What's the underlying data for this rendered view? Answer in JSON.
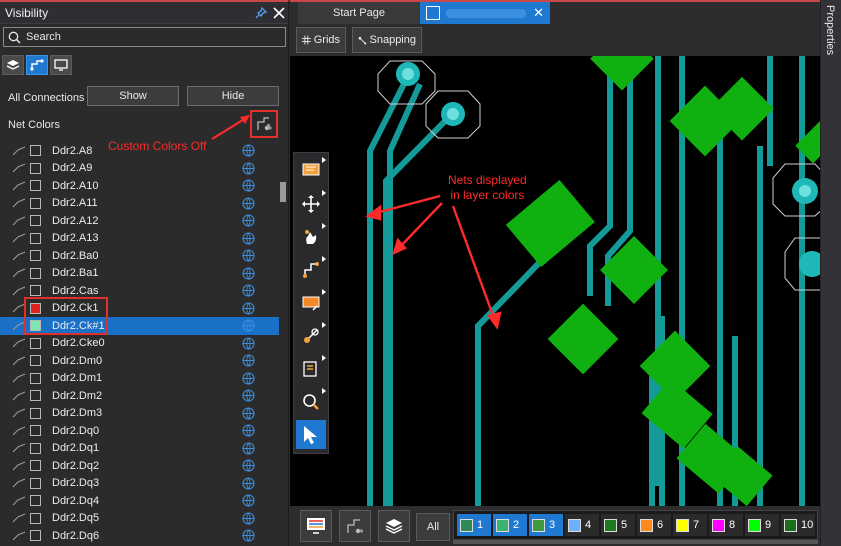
{
  "visibility": {
    "title": "Visibility",
    "search_placeholder": "Search",
    "all_connections_label": "All Connections",
    "show_label": "Show",
    "hide_label": "Hide",
    "net_colors_label": "Net Colors",
    "annotation_custom_colors": "Custom Colors Off",
    "nets": [
      {
        "name": "Ddr2.A8"
      },
      {
        "name": "Ddr2.A9"
      },
      {
        "name": "Ddr2.A10"
      },
      {
        "name": "Ddr2.A11"
      },
      {
        "name": "Ddr2.A12"
      },
      {
        "name": "Ddr2.A13"
      },
      {
        "name": "Ddr2.Ba0"
      },
      {
        "name": "Ddr2.Ba1"
      },
      {
        "name": "Ddr2.Cas"
      },
      {
        "name": "Ddr2.Ck1",
        "color": "#e0241c"
      },
      {
        "name": "Ddr2.Ck#1",
        "color": "#7ee6b0",
        "selected": true
      },
      {
        "name": "Ddr2.Cke0"
      },
      {
        "name": "Ddr2.Dm0"
      },
      {
        "name": "Ddr2.Dm1"
      },
      {
        "name": "Ddr2.Dm2"
      },
      {
        "name": "Ddr2.Dm3"
      },
      {
        "name": "Ddr2.Dq0"
      },
      {
        "name": "Ddr2.Dq1"
      },
      {
        "name": "Ddr2.Dq2"
      },
      {
        "name": "Ddr2.Dq3"
      },
      {
        "name": "Ddr2.Dq4"
      },
      {
        "name": "Ddr2.Dq5"
      },
      {
        "name": "Ddr2.Dq6"
      }
    ]
  },
  "tabs": {
    "start_page": "Start Page"
  },
  "toolbar": {
    "grids_label": "Grids",
    "snapping_label": "Snapping"
  },
  "properties_label": "Properties",
  "canvas": {
    "annotation_nets_line1": "Nets displayed",
    "annotation_nets_line2": "in layer colors"
  },
  "bottom": {
    "all_label": "All",
    "layers": [
      {
        "num": "1",
        "color": "#2e8b57",
        "on": true
      },
      {
        "num": "2",
        "color": "#3cb371",
        "on": true
      },
      {
        "num": "3",
        "color": "#3f9a3f",
        "on": true
      },
      {
        "num": "4",
        "color": "#6fb0ff",
        "on": false
      },
      {
        "num": "5",
        "color": "#1e7a1e",
        "on": false
      },
      {
        "num": "6",
        "color": "#ff8c1a",
        "on": false
      },
      {
        "num": "7",
        "color": "#ffff00",
        "on": false
      },
      {
        "num": "8",
        "color": "#ff00ff",
        "on": false
      },
      {
        "num": "9",
        "color": "#00ff00",
        "on": false
      },
      {
        "num": "10",
        "color": "#1a6e1a",
        "on": false
      }
    ]
  },
  "colors": {
    "accent": "#1f79d1",
    "trace": "#159a9a",
    "pad": "#10b010",
    "annotation": "#ff2a2a"
  }
}
